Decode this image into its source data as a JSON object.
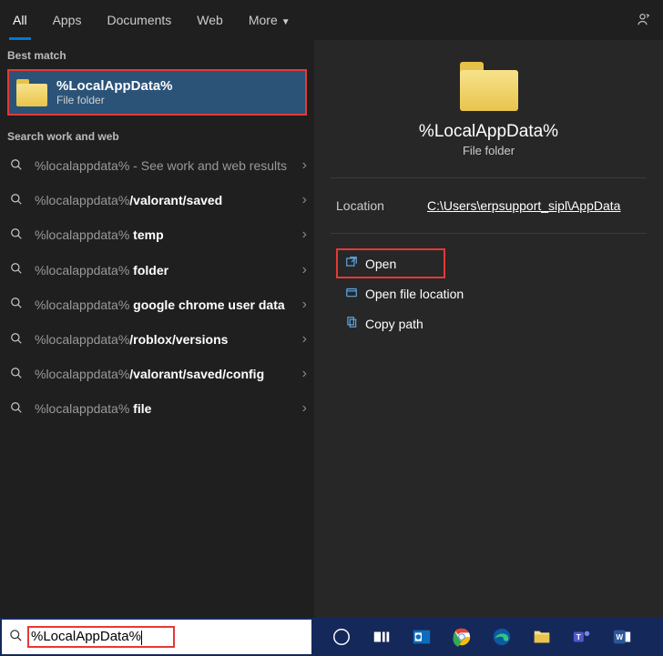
{
  "tabs": {
    "all": "All",
    "apps": "Apps",
    "documents": "Documents",
    "web": "Web",
    "more": "More"
  },
  "sections": {
    "best_match": "Best match",
    "search_work_web": "Search work and web"
  },
  "best_match": {
    "title": "%LocalAppData%",
    "subtitle": "File folder"
  },
  "suggestions": [
    {
      "prefix": "%localappdata%",
      "suffix": " - See work and web results",
      "suffix_dim": true
    },
    {
      "prefix": "%localappdata%",
      "suffix": "/valorant/saved"
    },
    {
      "prefix": "%localappdata%",
      "suffix": " temp"
    },
    {
      "prefix": "%localappdata%",
      "suffix": " folder"
    },
    {
      "prefix": "%localappdata%",
      "suffix": " google chrome user data"
    },
    {
      "prefix": "%localappdata%",
      "suffix": "/roblox/versions"
    },
    {
      "prefix": "%localappdata%",
      "suffix": "/valorant/saved/config"
    },
    {
      "prefix": "%localappdata%",
      "suffix": " file"
    }
  ],
  "preview": {
    "title": "%LocalAppData%",
    "subtitle": "File folder",
    "location_label": "Location",
    "location_value": "C:\\Users\\erpsupport_sipl\\AppData"
  },
  "actions": {
    "open": "Open",
    "open_loc": "Open file location",
    "copy": "Copy path"
  },
  "search": {
    "value": "%LocalAppData%"
  }
}
